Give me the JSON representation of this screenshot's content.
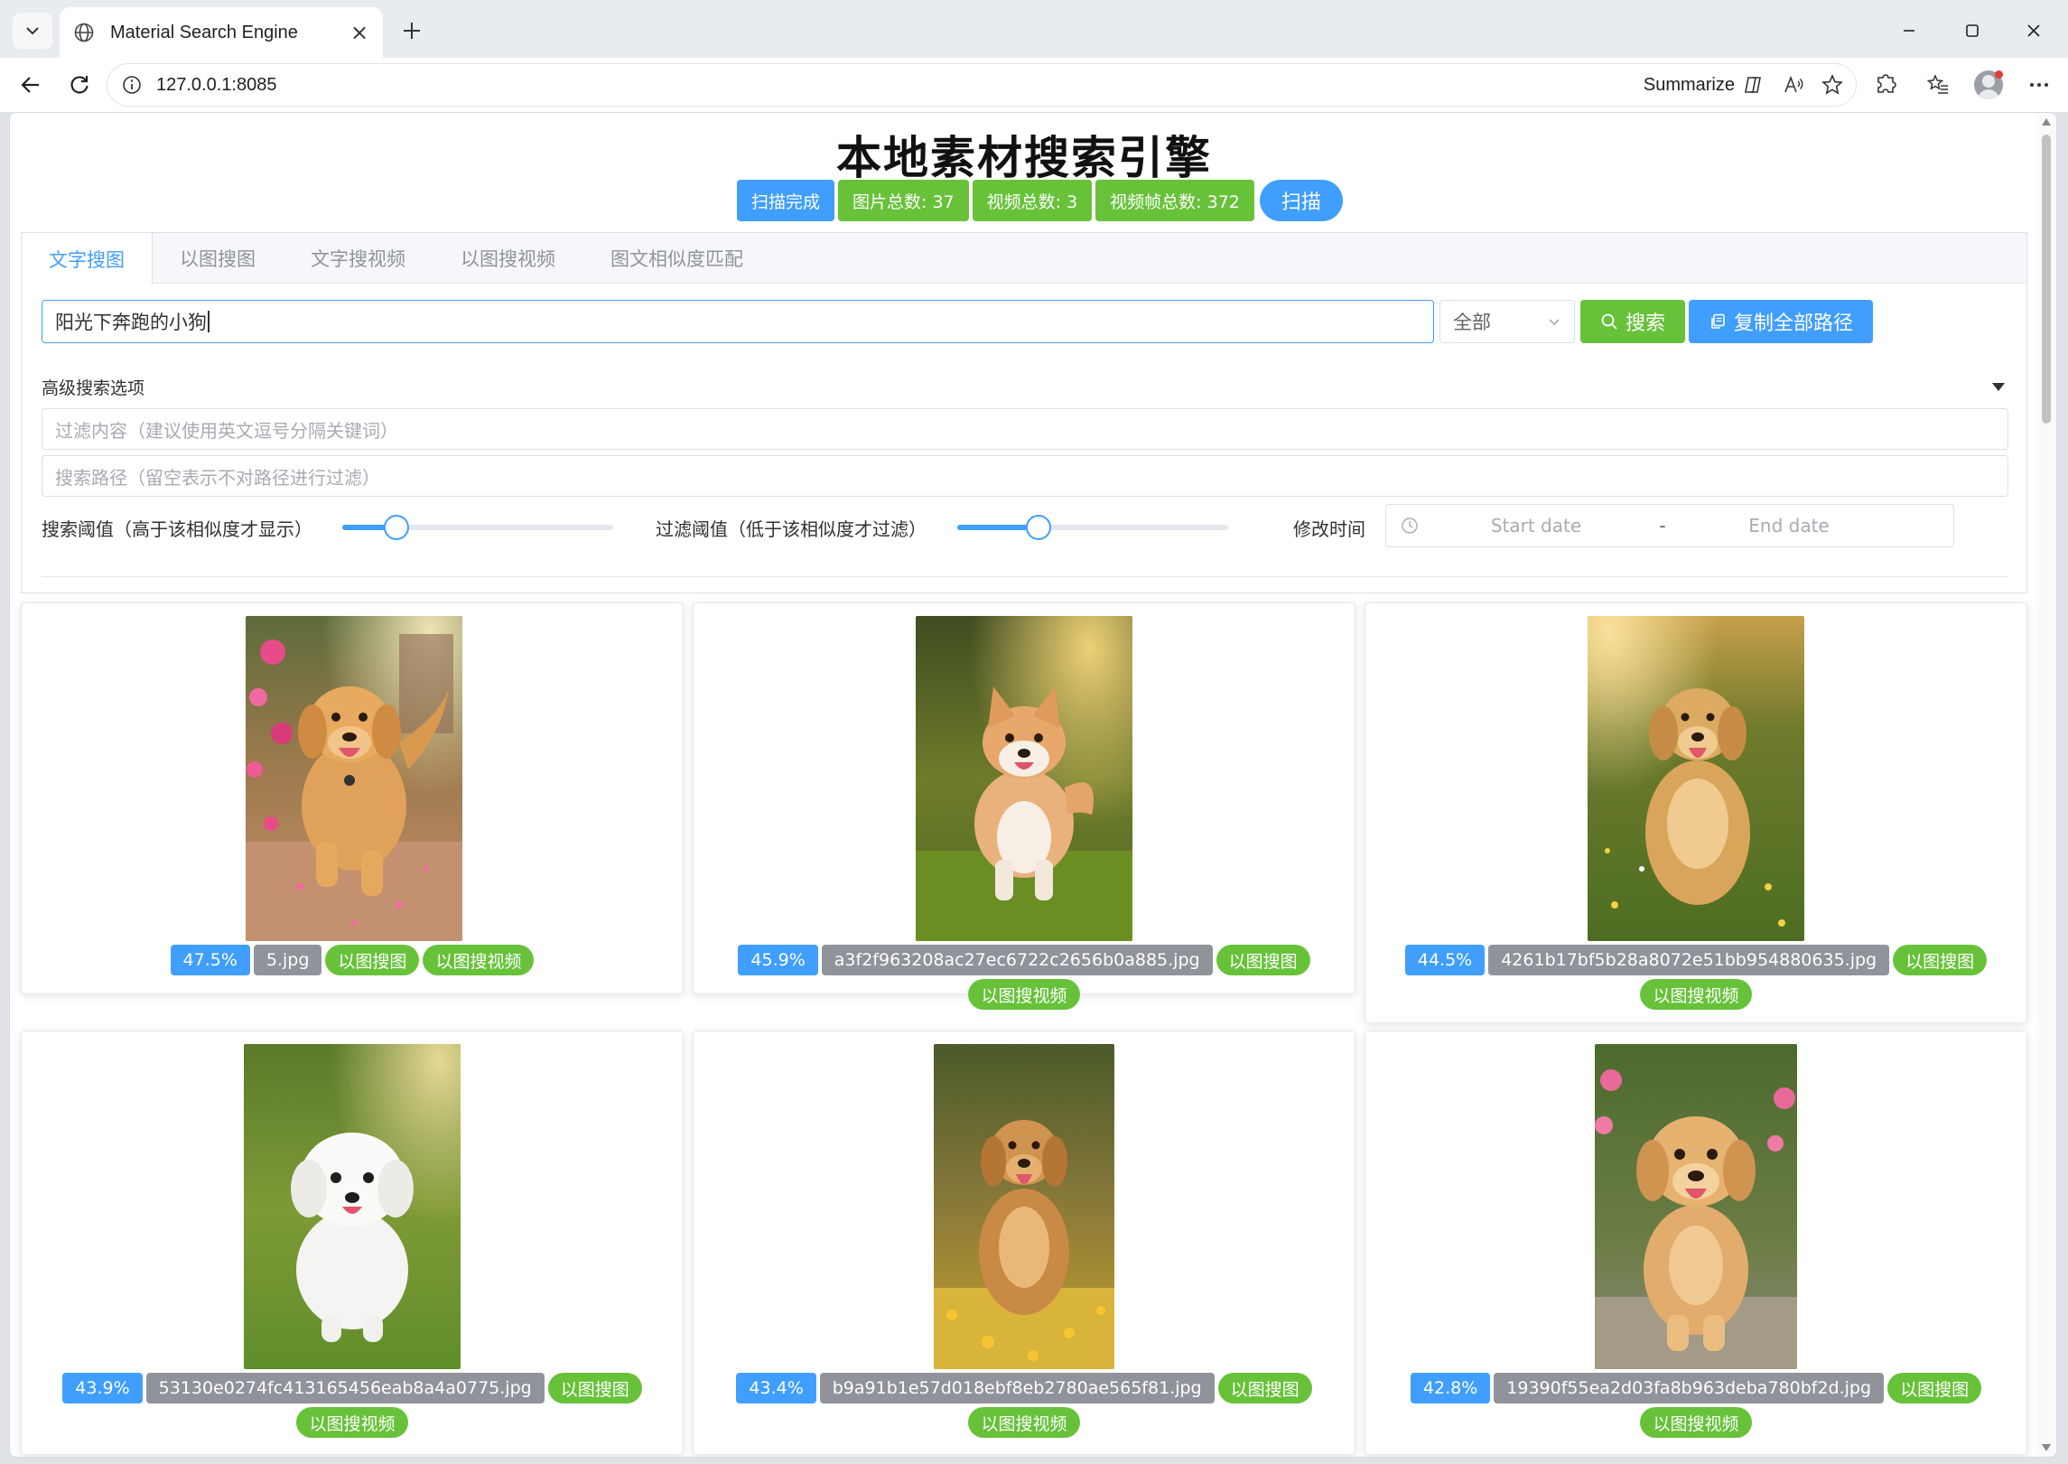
{
  "browser": {
    "tab_title": "Material Search Engine",
    "url": "127.0.0.1:8085",
    "summarize_label": "Summarize"
  },
  "app": {
    "title": "本地素材搜索引擎",
    "stats": {
      "status": "扫描完成",
      "image_total": "图片总数: 37",
      "video_total": "视频总数: 3",
      "frame_total": "视频帧总数: 372"
    },
    "scan_button": "扫描"
  },
  "tabs": [
    {
      "label": "文字搜图",
      "active": true
    },
    {
      "label": "以图搜图",
      "active": false
    },
    {
      "label": "文字搜视频",
      "active": false
    },
    {
      "label": "以图搜视频",
      "active": false
    },
    {
      "label": "图文相似度匹配",
      "active": false
    }
  ],
  "search": {
    "query": "阳光下奔跑的小狗",
    "scope_select": "全部",
    "search_button": "搜索",
    "copy_button": "复制全部路径"
  },
  "advanced": {
    "header": "高级搜索选项",
    "filter_placeholder": "过滤内容（建议使用英文逗号分隔关键词）",
    "path_placeholder": "搜索路径（留空表示不对路径进行过滤）",
    "search_threshold_label": "搜索阈值（高于该相似度才显示）",
    "search_threshold_value": 0.2,
    "filter_threshold_label": "过滤阈值（低于该相似度才过滤）",
    "filter_threshold_value": 0.3,
    "modified_time_label": "修改时间",
    "start_placeholder": "Start date",
    "end_placeholder": "End date",
    "range_separator": "-"
  },
  "results": [
    {
      "score": "47.5%",
      "filename": "5.jpg",
      "action_image": "以图搜图",
      "action_video": "以图搜视频",
      "scene": "path-running"
    },
    {
      "score": "45.9%",
      "filename": "a3f2f963208ac27ec6722c2656b0a885.jpg",
      "action_image": "以图搜图",
      "action_video": "以图搜视频",
      "scene": "shiba-grass"
    },
    {
      "score": "44.5%",
      "filename": "4261b17bf5b28a8072e51bb954880635.jpg",
      "action_image": "以图搜图",
      "action_video": "以图搜视频",
      "scene": "golden-meadow"
    },
    {
      "score": "43.9%",
      "filename": "53130e0274fc413165456eab8a4a0775.jpg",
      "action_image": "以图搜图",
      "action_video": "以图搜视频",
      "scene": "white-puppy"
    },
    {
      "score": "43.4%",
      "filename": "b9a91b1e57d018ebf8eb2780ae565f81.jpg",
      "action_image": "以图搜图",
      "action_video": "以图搜视频",
      "scene": "golden-flowers"
    },
    {
      "score": "42.8%",
      "filename": "19390f55ea2d03fa8b963deba780bf2d.jpg",
      "action_image": "以图搜图",
      "action_video": "以图搜视频",
      "scene": "golden-pink"
    }
  ],
  "colors": {
    "primary": "#409eff",
    "success": "#67c23a",
    "info": "#909399"
  }
}
